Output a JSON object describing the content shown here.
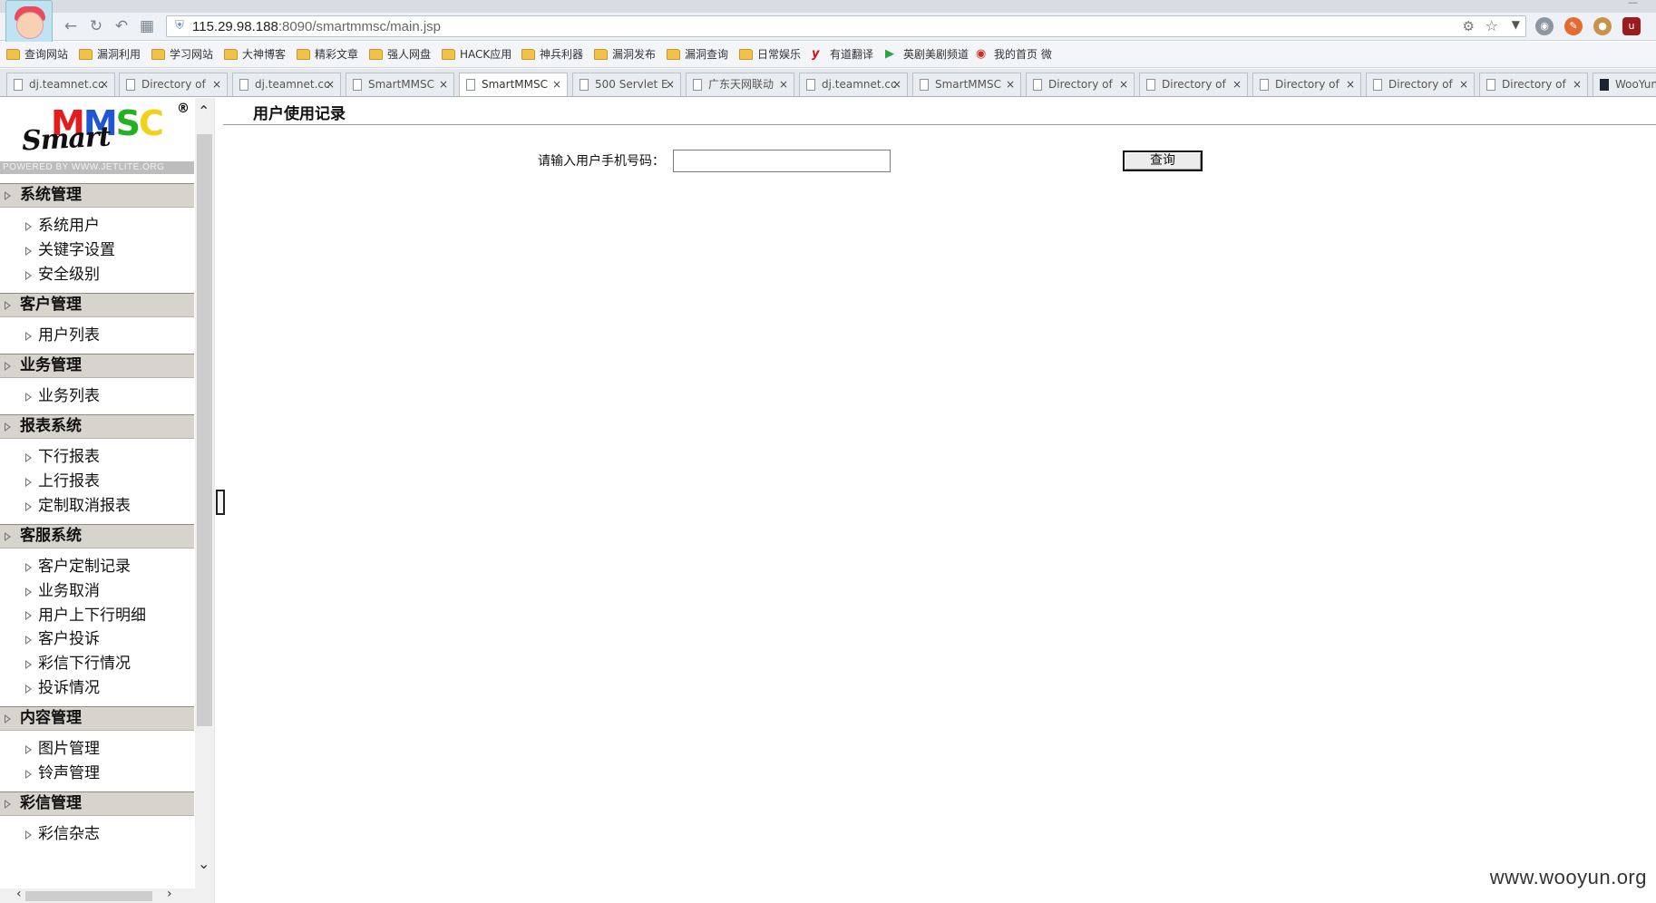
{
  "browser": {
    "url_host": "115.29.98.188",
    "url_rest": ":8090/smartmmsc/main.jsp"
  },
  "bookmarks": [
    {
      "label": "查询网站",
      "icon": "folder-icon"
    },
    {
      "label": "漏洞利用",
      "icon": "folder-icon"
    },
    {
      "label": "学习网站",
      "icon": "folder-icon"
    },
    {
      "label": "大神博客",
      "icon": "folder-icon"
    },
    {
      "label": "精彩文章",
      "icon": "folder-icon"
    },
    {
      "label": "强人网盘",
      "icon": "folder-icon"
    },
    {
      "label": "HACK应用",
      "icon": "folder-icon"
    },
    {
      "label": "神兵利器",
      "icon": "folder-icon"
    },
    {
      "label": "漏洞发布",
      "icon": "folder-icon"
    },
    {
      "label": "漏洞查询",
      "icon": "folder-icon"
    },
    {
      "label": "日常娱乐",
      "icon": "folder-icon"
    },
    {
      "label": "有道翻译",
      "icon": "youdao-icon"
    },
    {
      "label": "英剧美剧频道",
      "icon": "play-icon"
    },
    {
      "label": "我的首页 微",
      "icon": "weibo-icon"
    }
  ],
  "tabs": [
    {
      "label": "dj.teamnet.cc",
      "close": "×"
    },
    {
      "label": "Directory of",
      "close": "×"
    },
    {
      "label": "dj.teamnet.cc",
      "close": "×"
    },
    {
      "label": "SmartMMSC",
      "close": "×"
    },
    {
      "label": "SmartMMSC",
      "close": "×",
      "active": true
    },
    {
      "label": "500 Servlet E",
      "close": "×"
    },
    {
      "label": "广东天网联动",
      "close": "×"
    },
    {
      "label": "dj.teamnet.cc",
      "close": "×"
    },
    {
      "label": "SmartMMSC",
      "close": "×"
    },
    {
      "label": "Directory of",
      "close": "×"
    },
    {
      "label": "Directory of",
      "close": "×"
    },
    {
      "label": "Directory of",
      "close": "×"
    },
    {
      "label": "Directory of",
      "close": "×"
    },
    {
      "label": "Directory of",
      "close": "×"
    },
    {
      "label": "WooYun",
      "close": ""
    }
  ],
  "logo": {
    "smart": "Smart",
    "m1": "M",
    "m2": "M",
    "s": "S",
    "c": "C",
    "reg": "®",
    "powered": "POWERED BY WWW.JETLITE.ORG"
  },
  "menu": [
    {
      "title": "系统管理",
      "items": [
        "系统用户",
        "关键字设置",
        "安全级别"
      ]
    },
    {
      "title": "客户管理",
      "items": [
        "用户列表"
      ]
    },
    {
      "title": "业务管理",
      "items": [
        "业务列表"
      ]
    },
    {
      "title": "报表系统",
      "items": [
        "下行报表",
        "上行报表",
        "定制取消报表"
      ]
    },
    {
      "title": "客服系统",
      "items": [
        "客户定制记录",
        "业务取消",
        "用户上下行明细",
        "客户投诉",
        "彩信下行情况",
        "投诉情况"
      ]
    },
    {
      "title": "内容管理",
      "items": [
        "图片管理",
        "铃声管理"
      ]
    },
    {
      "title": "彩信管理",
      "items": [
        "彩信杂志"
      ]
    }
  ],
  "main": {
    "title": "用户使用记录",
    "query_label": "请输入用户手机号码：",
    "query_value": "",
    "query_button": "查询"
  },
  "watermark": "www.wooyun.org"
}
